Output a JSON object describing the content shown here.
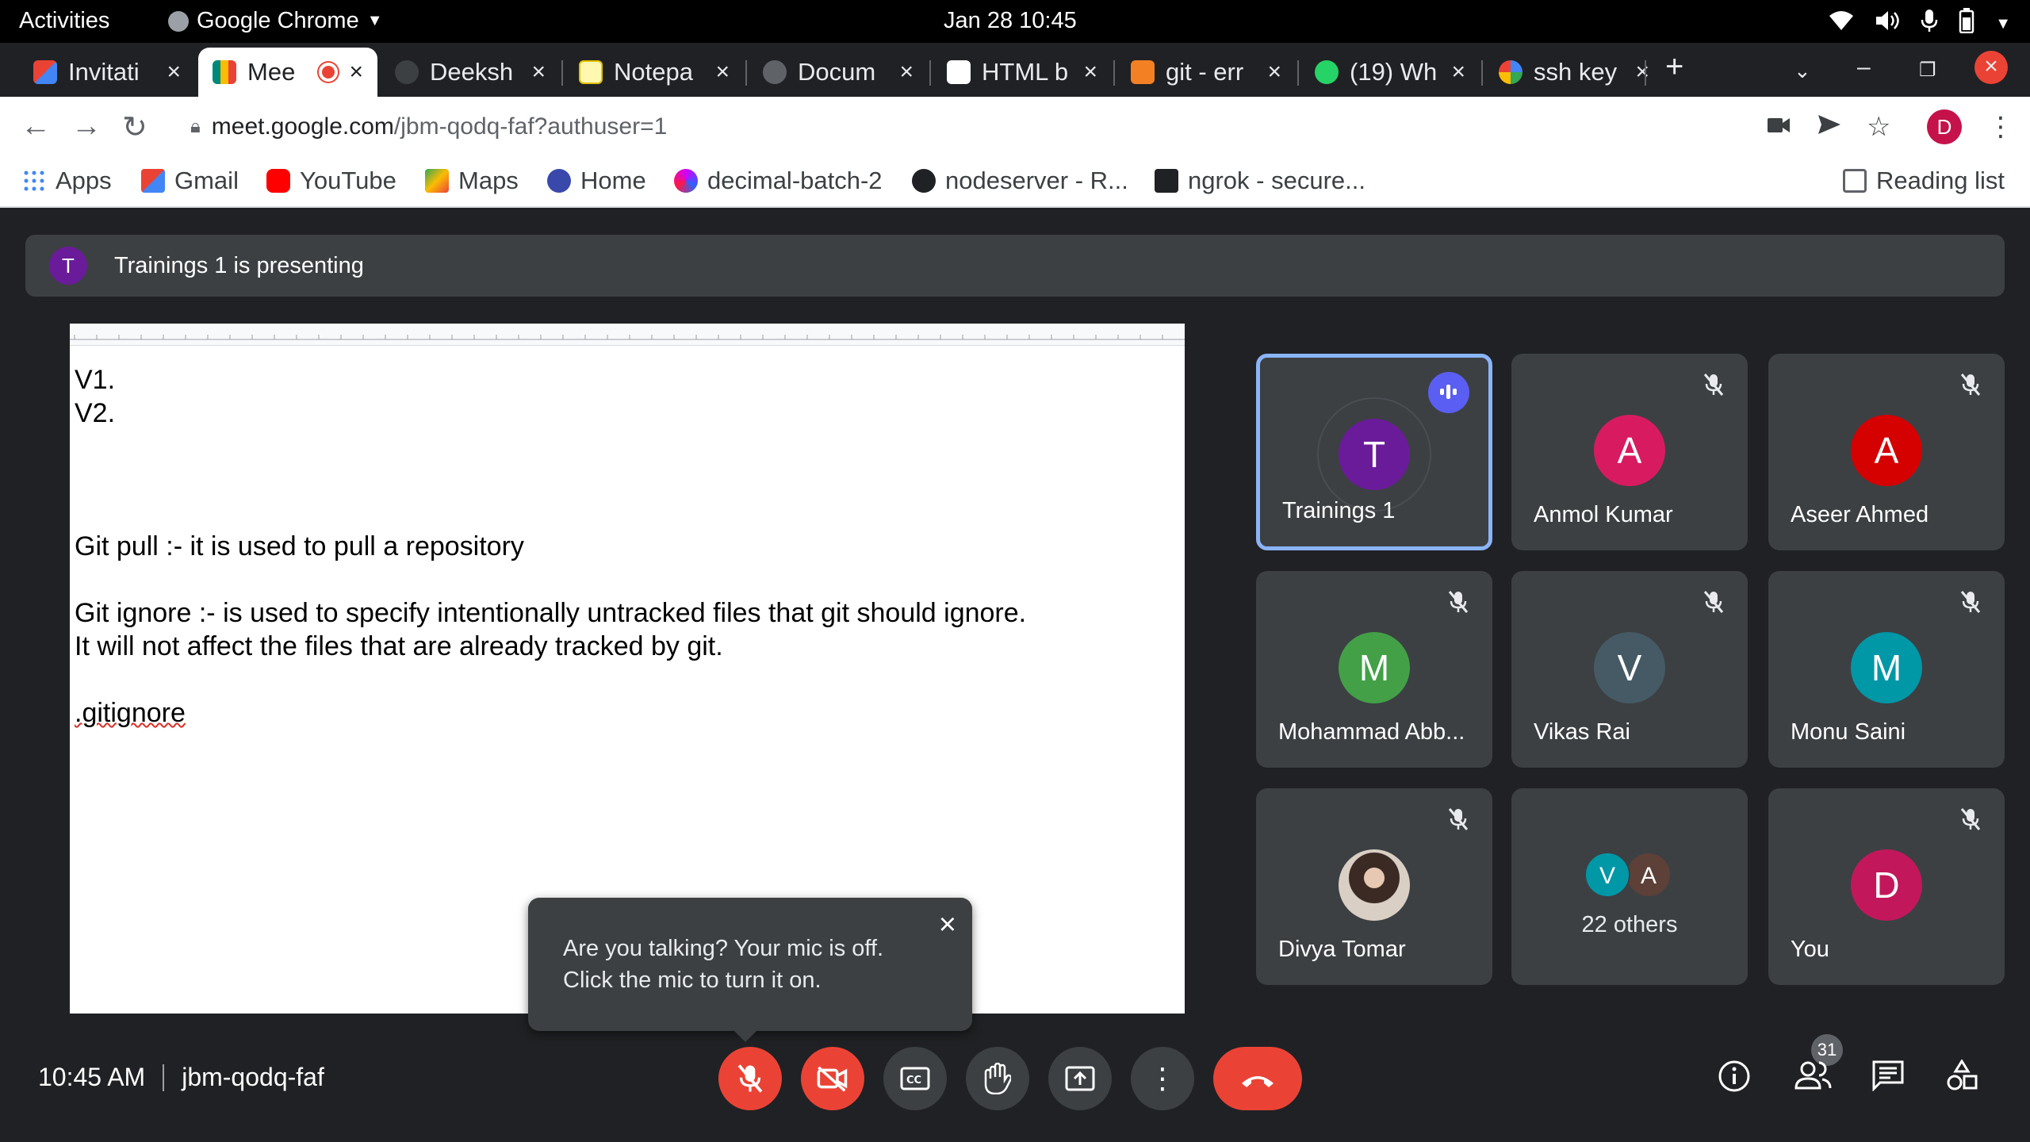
{
  "system": {
    "activities": "Activities",
    "app_name": "Google Chrome",
    "clock": "Jan 28  10:45"
  },
  "tabs": [
    {
      "label": "Invitati",
      "icon": "gmail-icon",
      "color": "#ea4335"
    },
    {
      "label": "Mee",
      "icon": "meet-icon",
      "color": "#00897b",
      "active": true
    },
    {
      "label": "Deeksh",
      "icon": "github-icon",
      "color": "#24292e"
    },
    {
      "label": "Notepa",
      "icon": "notepad-icon",
      "color": "#fbbc04"
    },
    {
      "label": "Docum",
      "icon": "globe-icon",
      "color": "#9aa0a6"
    },
    {
      "label": "HTML b",
      "icon": "site-icon",
      "color": "#ffffff"
    },
    {
      "label": "git - err",
      "icon": "stackoverflow-icon",
      "color": "#f48024"
    },
    {
      "label": "(19) Wh",
      "icon": "whatsapp-icon",
      "color": "#25d366"
    },
    {
      "label": "ssh key",
      "icon": "google-icon",
      "color": "#4285f4"
    }
  ],
  "address": {
    "host": "meet.google.com",
    "path": "/jbm-qodq-faf?authuser=1",
    "profile_initial": "D"
  },
  "bookmarks": [
    {
      "label": "Apps",
      "icon": "apps-grid-icon",
      "color": "#4285f4"
    },
    {
      "label": "Gmail",
      "icon": "gmail-icon",
      "color": "#ea4335"
    },
    {
      "label": "YouTube",
      "icon": "youtube-icon",
      "color": "#ff0000"
    },
    {
      "label": "Maps",
      "icon": "maps-icon",
      "color": "#34a853"
    },
    {
      "label": "Home",
      "icon": "home-site-icon",
      "color": "#3949ab"
    },
    {
      "label": "decimal-batch-2",
      "icon": "site-icon",
      "color": "#d500f9"
    },
    {
      "label": "nodeserver - R...",
      "icon": "replit-icon",
      "color": "#202124"
    },
    {
      "label": "ngrok - secure...",
      "icon": "ngrok-icon",
      "color": "#202124"
    }
  ],
  "reading_list": "Reading list",
  "presenting": {
    "initial": "T",
    "text": "Trainings 1 is presenting"
  },
  "document": {
    "lines": [
      "V1.",
      "V2.",
      "",
      "",
      "",
      "Git pull :- it is used to pull a repository",
      "",
      "Git ignore :- is used to specify intentionally untracked files that git should ignore.",
      "It will not affect the files that are already tracked by git.",
      "",
      ".gitignore"
    ]
  },
  "toast": {
    "line1": "Are you talking? Your mic is off.",
    "line2": "Click the mic to turn it on."
  },
  "participants": [
    {
      "name": "Trainings 1",
      "initial": "T",
      "color": "#6a1b9a",
      "speaking": true
    },
    {
      "name": "Anmol Kumar",
      "initial": "A",
      "color": "#d81b60"
    },
    {
      "name": "Aseer Ahmed",
      "initial": "A",
      "color": "#d50000"
    },
    {
      "name": "Mohammad Abb...",
      "initial": "M",
      "color": "#43a047"
    },
    {
      "name": "Vikas Rai",
      "initial": "V",
      "color": "#455a64"
    },
    {
      "name": "Monu Saini",
      "initial": "M",
      "color": "#0097a7"
    },
    {
      "name": "Divya Tomar",
      "initial": "",
      "color": "#3a2a23"
    },
    {
      "name": "22 others",
      "initial": "",
      "color": "#3c4043",
      "minis": [
        {
          "initial": "V",
          "color": "#0097a7"
        },
        {
          "initial": "A",
          "color": "#5d4037"
        }
      ]
    },
    {
      "name": "You",
      "initial": "D",
      "color": "#c2185b"
    }
  ],
  "meeting": {
    "time": "10:45 AM",
    "code": "jbm-qodq-faf",
    "participant_count": "31"
  }
}
